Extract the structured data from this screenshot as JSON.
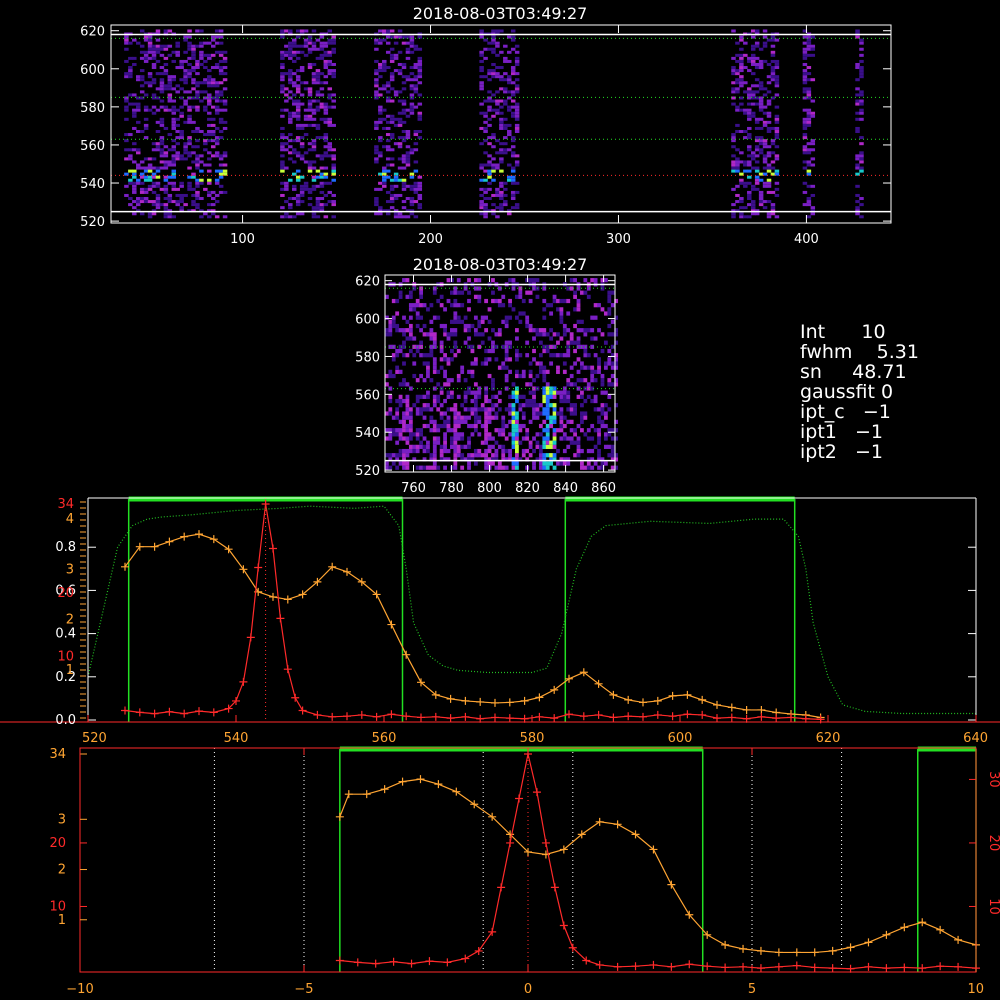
{
  "colors": {
    "background": "#000000",
    "axis": "#ffffff",
    "red": "#ff2a2a",
    "orange": "#ffa533",
    "green": "#22e022",
    "dotted_green": "#22c022"
  },
  "params": [
    {
      "label": "Int",
      "value": "10"
    },
    {
      "label": "fwhm",
      "value": "5.31"
    },
    {
      "label": "sn",
      "value": "48.71"
    },
    {
      "label": "gaussfit",
      "value": "0"
    },
    {
      "label": "ipt_c",
      "value": "−1"
    },
    {
      "label": "ipt1",
      "value": "−1"
    },
    {
      "label": "ipt2",
      "value": "−1"
    }
  ],
  "chart_data": [
    {
      "type": "heatmap",
      "title": "2018-08-03T03:49:27",
      "xlim": [
        30,
        445
      ],
      "ylim": [
        519,
        623
      ],
      "x_ticks": [
        "100",
        "200",
        "300",
        "400"
      ],
      "y_ticks": [
        "520",
        "540",
        "560",
        "580",
        "600",
        "620"
      ],
      "white_lines_y": [
        525,
        618
      ],
      "dotted_lines": [
        {
          "y": 616,
          "color": "green"
        },
        {
          "y": 585,
          "color": "green"
        },
        {
          "y": 563,
          "color": "green"
        },
        {
          "y": 544,
          "color": "red"
        }
      ],
      "bright_bands": [
        [
          37,
          90
        ],
        [
          120,
          148
        ],
        [
          170,
          195
        ],
        [
          226,
          246
        ],
        [
          360,
          385
        ],
        [
          398,
          404
        ],
        [
          426,
          429
        ]
      ],
      "emission_row_y": 544
    },
    {
      "type": "heatmap",
      "title": "2018-08-03T03:49:27",
      "xlim": [
        745,
        866
      ],
      "ylim": [
        519,
        623
      ],
      "x_ticks": [
        "760",
        "780",
        "800",
        "820",
        "840",
        "860"
      ],
      "y_ticks": [
        "520",
        "540",
        "560",
        "580",
        "600",
        "620"
      ],
      "white_lines_y": [
        525,
        618
      ],
      "dotted_lines": [
        {
          "y": 616,
          "color": "green"
        },
        {
          "y": 585,
          "color": "green"
        },
        {
          "y": 563,
          "color": "green"
        }
      ],
      "bright_columns_x": [
        812,
        828,
        830,
        832
      ],
      "medium_columns_x": [
        755,
        770,
        782,
        797,
        799
      ]
    },
    {
      "type": "line",
      "xlim": [
        520,
        640
      ],
      "x_ticks": [
        "520",
        "540",
        "560",
        "580",
        "600",
        "620",
        "640"
      ],
      "left_axis_white": {
        "ylim": [
          0,
          1
        ],
        "ticks": [
          "0.0",
          "0.2",
          "0.4",
          "0.6",
          "0.8"
        ]
      },
      "left_axis_orange": {
        "ylim": [
          0,
          4.3
        ],
        "ticks": [
          "1",
          "2",
          "3",
          "4"
        ]
      },
      "left_axis_red": {
        "ylim": [
          0,
          34
        ],
        "ticks": [
          "10",
          "20",
          "34"
        ]
      },
      "green_boxes": [
        [
          525.5,
          562.5
        ],
        [
          584.5,
          615.5
        ]
      ],
      "red_dotted_x": 544,
      "series": [
        {
          "color": "orange",
          "axis": "orange",
          "x": [
            525,
            527,
            529,
            531,
            533,
            535,
            537,
            539,
            541,
            543,
            545,
            547,
            549,
            551,
            553,
            555,
            557,
            559,
            561,
            563,
            565,
            567,
            569,
            571,
            573,
            575,
            577,
            579,
            581,
            583,
            585,
            587,
            589,
            591,
            593,
            595,
            597,
            599,
            601,
            603,
            605,
            607,
            609,
            611,
            613,
            615,
            617,
            619
          ],
          "values": [
            3.05,
            3.45,
            3.45,
            3.55,
            3.65,
            3.7,
            3.6,
            3.4,
            3.0,
            2.55,
            2.45,
            2.4,
            2.5,
            2.75,
            3.05,
            2.95,
            2.75,
            2.5,
            1.9,
            1.3,
            0.75,
            0.5,
            0.42,
            0.38,
            0.36,
            0.34,
            0.35,
            0.38,
            0.45,
            0.6,
            0.82,
            0.95,
            0.72,
            0.5,
            0.4,
            0.35,
            0.38,
            0.48,
            0.5,
            0.4,
            0.3,
            0.25,
            0.2,
            0.2,
            0.15,
            0.12,
            0.1,
            0.05
          ]
        },
        {
          "color": "red",
          "axis": "red",
          "x": [
            525,
            527,
            529,
            531,
            533,
            535,
            537,
            539,
            540,
            541,
            542,
            543,
            544,
            545,
            546,
            547,
            548,
            549,
            551,
            553,
            555,
            557,
            559,
            561,
            563,
            565,
            567,
            569,
            571,
            573,
            575,
            577,
            579,
            581,
            583,
            585,
            587,
            589,
            591,
            593,
            595,
            597,
            599,
            601,
            603,
            605,
            607,
            609,
            611,
            613,
            615,
            617,
            619
          ],
          "values": [
            1.5,
            1.2,
            1.0,
            1.3,
            1.0,
            1.4,
            1.2,
            1.8,
            3.0,
            6.0,
            13.0,
            24.0,
            34.0,
            27.0,
            16.0,
            8.0,
            3.5,
            1.5,
            0.8,
            0.5,
            0.6,
            0.8,
            0.5,
            0.9,
            0.6,
            0.4,
            0.5,
            0.3,
            0.5,
            0.2,
            0.4,
            0.3,
            0.2,
            0.5,
            0.3,
            0.9,
            0.6,
            0.8,
            0.4,
            0.6,
            0.5,
            0.8,
            0.6,
            0.9,
            0.8,
            0.3,
            0.4,
            0.2,
            0.5,
            0.3,
            0.4,
            0.2,
            0.1
          ]
        },
        {
          "color": "dotted_green",
          "axis": "white",
          "dotted": true,
          "x": [
            520,
            522,
            524,
            526,
            528,
            530,
            534,
            540,
            546,
            550,
            556,
            560,
            562,
            563,
            564,
            566,
            568,
            570,
            574,
            580,
            582,
            584,
            586,
            588,
            590,
            596,
            604,
            610,
            614,
            616,
            617,
            618,
            620,
            622,
            625,
            630,
            640
          ],
          "values": [
            0.2,
            0.5,
            0.8,
            0.9,
            0.93,
            0.94,
            0.95,
            0.97,
            0.98,
            0.99,
            0.98,
            0.99,
            0.9,
            0.7,
            0.45,
            0.3,
            0.25,
            0.23,
            0.22,
            0.22,
            0.24,
            0.4,
            0.7,
            0.85,
            0.9,
            0.92,
            0.91,
            0.93,
            0.93,
            0.85,
            0.7,
            0.45,
            0.2,
            0.07,
            0.04,
            0.03,
            0.03
          ]
        }
      ]
    },
    {
      "type": "line",
      "xlim": [
        -10,
        10
      ],
      "x_ticks": [
        "−10",
        "−5",
        "0",
        "5",
        "10"
      ],
      "left_axis_orange": {
        "ylim": [
          0,
          4.3
        ],
        "ticks": [
          "1",
          "2",
          "3",
          "34"
        ]
      },
      "left_axis_red": {
        "ylim": [
          0,
          34
        ],
        "ticks": [
          "10",
          "20"
        ]
      },
      "right_axis_red": {
        "ylim": [
          0,
          34
        ],
        "ticks": [
          "10",
          "20",
          "30"
        ]
      },
      "green_boxes": [
        [
          -4.2,
          3.9
        ],
        [
          8.7,
          10
        ]
      ],
      "dotted_lines_x": [
        -7,
        -5,
        -1,
        0,
        1,
        5,
        7
      ],
      "series": [
        {
          "color": "orange",
          "axis": "orange",
          "x": [
            -4.2,
            -4.0,
            -3.6,
            -3.2,
            -2.8,
            -2.4,
            -2.0,
            -1.6,
            -1.2,
            -0.8,
            -0.4,
            0.0,
            0.4,
            0.8,
            1.2,
            1.6,
            2.0,
            2.4,
            2.8,
            3.2,
            3.6,
            4.0,
            4.4,
            4.8,
            5.2,
            5.6,
            6.0,
            6.4,
            6.8,
            7.2,
            7.6,
            8.0,
            8.4,
            8.8,
            9.2,
            9.6,
            10.0
          ],
          "values": [
            3.05,
            3.5,
            3.5,
            3.6,
            3.75,
            3.8,
            3.7,
            3.55,
            3.3,
            3.05,
            2.7,
            2.35,
            2.3,
            2.4,
            2.7,
            2.95,
            2.9,
            2.7,
            2.4,
            1.7,
            1.1,
            0.7,
            0.5,
            0.42,
            0.38,
            0.35,
            0.35,
            0.35,
            0.38,
            0.45,
            0.55,
            0.7,
            0.85,
            0.95,
            0.8,
            0.6,
            0.5
          ]
        },
        {
          "color": "red",
          "axis": "red",
          "x": [
            -4.2,
            -3.8,
            -3.4,
            -3.0,
            -2.6,
            -2.2,
            -1.8,
            -1.4,
            -1.1,
            -0.8,
            -0.6,
            -0.4,
            -0.2,
            0.0,
            0.2,
            0.4,
            0.6,
            0.8,
            1.0,
            1.3,
            1.6,
            2.0,
            2.4,
            2.8,
            3.2,
            3.6,
            4.0,
            4.4,
            4.8,
            5.2,
            5.6,
            6.0,
            6.4,
            6.8,
            7.2,
            7.6,
            8.0,
            8.4,
            8.8,
            9.2,
            9.6,
            10.0
          ],
          "values": [
            1.5,
            1.2,
            1.0,
            1.3,
            1.0,
            1.4,
            1.2,
            1.8,
            3.0,
            6.0,
            13.0,
            20.0,
            27.0,
            34.0,
            28.0,
            20.0,
            13.0,
            7.0,
            3.5,
            1.5,
            0.8,
            0.5,
            0.6,
            0.8,
            0.5,
            0.9,
            0.6,
            0.4,
            0.5,
            0.3,
            0.5,
            0.7,
            0.4,
            0.3,
            0.2,
            0.5,
            0.3,
            0.4,
            0.3,
            0.6,
            0.5,
            0.3
          ]
        }
      ]
    }
  ]
}
